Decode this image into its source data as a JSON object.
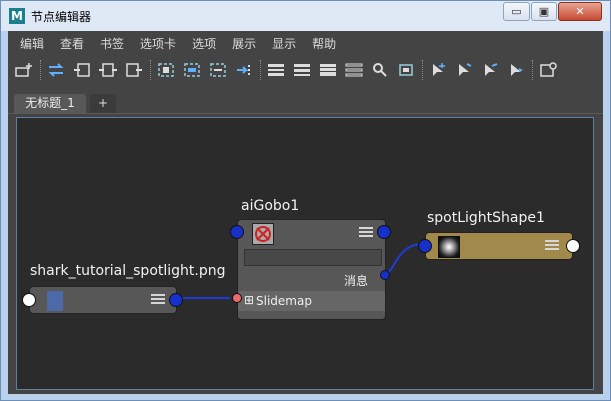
{
  "window": {
    "title": "节点编辑器",
    "logo": "M",
    "minimize_glyph": "▭",
    "restore_glyph": "▣",
    "close_glyph": "✕"
  },
  "menubar": {
    "items": [
      "编辑",
      "查看",
      "书签",
      "选项卡",
      "选项",
      "展示",
      "显示",
      "帮助"
    ]
  },
  "toolbar": {
    "icons": [
      "add-node-icon",
      "swap-arrows-icon",
      "input-connections-icon",
      "input-output-connections-icon",
      "output-connections-icon",
      "frame-all-icon",
      "frame-selected-icon",
      "layout-icon",
      "pin-icon",
      "simple-mode-icon",
      "connected-mode-icon",
      "full-mode-icon",
      "custom-mode-icon",
      "search-icon",
      "snapshot-icon",
      "pin-tab-icon",
      "bookmark-icon",
      "edit-bookmark-icon",
      "next-bookmark-icon",
      "settings-icon"
    ]
  },
  "tabs": {
    "active": "无标题_1",
    "add": "+"
  },
  "colors": {
    "graph_bg": "#2b2b2b",
    "node_bg": "#575757",
    "light_node_bg": "#a0894a",
    "port_blue": "#1630c8",
    "wire": "#1e3bd9",
    "selection_frame": "#5e7fa0"
  },
  "nodes": {
    "file_node": {
      "label": "shark_tutorial_spotlight.png"
    },
    "gobo_node": {
      "label": "aiGobo1",
      "message_label": "消息",
      "slidemap_label": "Slidemap",
      "expand_glyph": "⊞"
    },
    "light_node": {
      "label": "spotLightShape1"
    }
  }
}
